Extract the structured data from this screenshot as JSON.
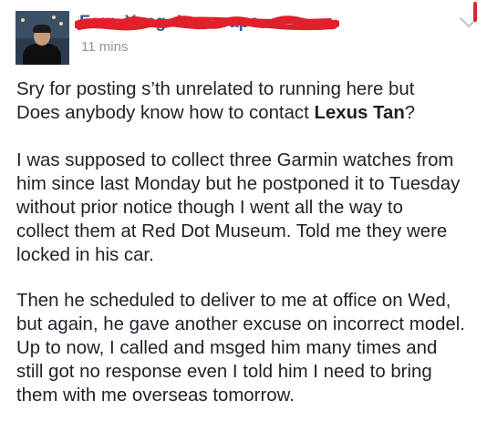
{
  "post": {
    "author_name": "Forr• Yang• Ironavapo",
    "timestamp": "11 mins",
    "menu_icon": "chevron-down-icon",
    "paragraphs": [
      {
        "lines": [
          "Sry for posting s’th unrelated to running here but",
          "Does anybody know how to contact "
        ],
        "mention": "Lexus Tan",
        "mention_suffix": "?"
      },
      {
        "lines": [
          "I was supposed to collect three Garmin watches from",
          "him since last Monday but he postponed it to Tuesday",
          "without prior notice though I went all the way to",
          "collect them at Red Dot Museum. Told me they were",
          "locked in his car."
        ]
      },
      {
        "lines": [
          "Then he scheduled to deliver to me at office on Wed,",
          "but again, he gave another excuse on incorrect model.",
          "Up to now, I called and msged him many times and",
          "still got no response even I told him I need to bring",
          "them with me overseas tomorrow."
        ]
      }
    ]
  },
  "colors": {
    "name_link": "#365899",
    "meta_gray": "#90949c",
    "body_text": "#1d2129",
    "redaction": "#e0202a"
  }
}
